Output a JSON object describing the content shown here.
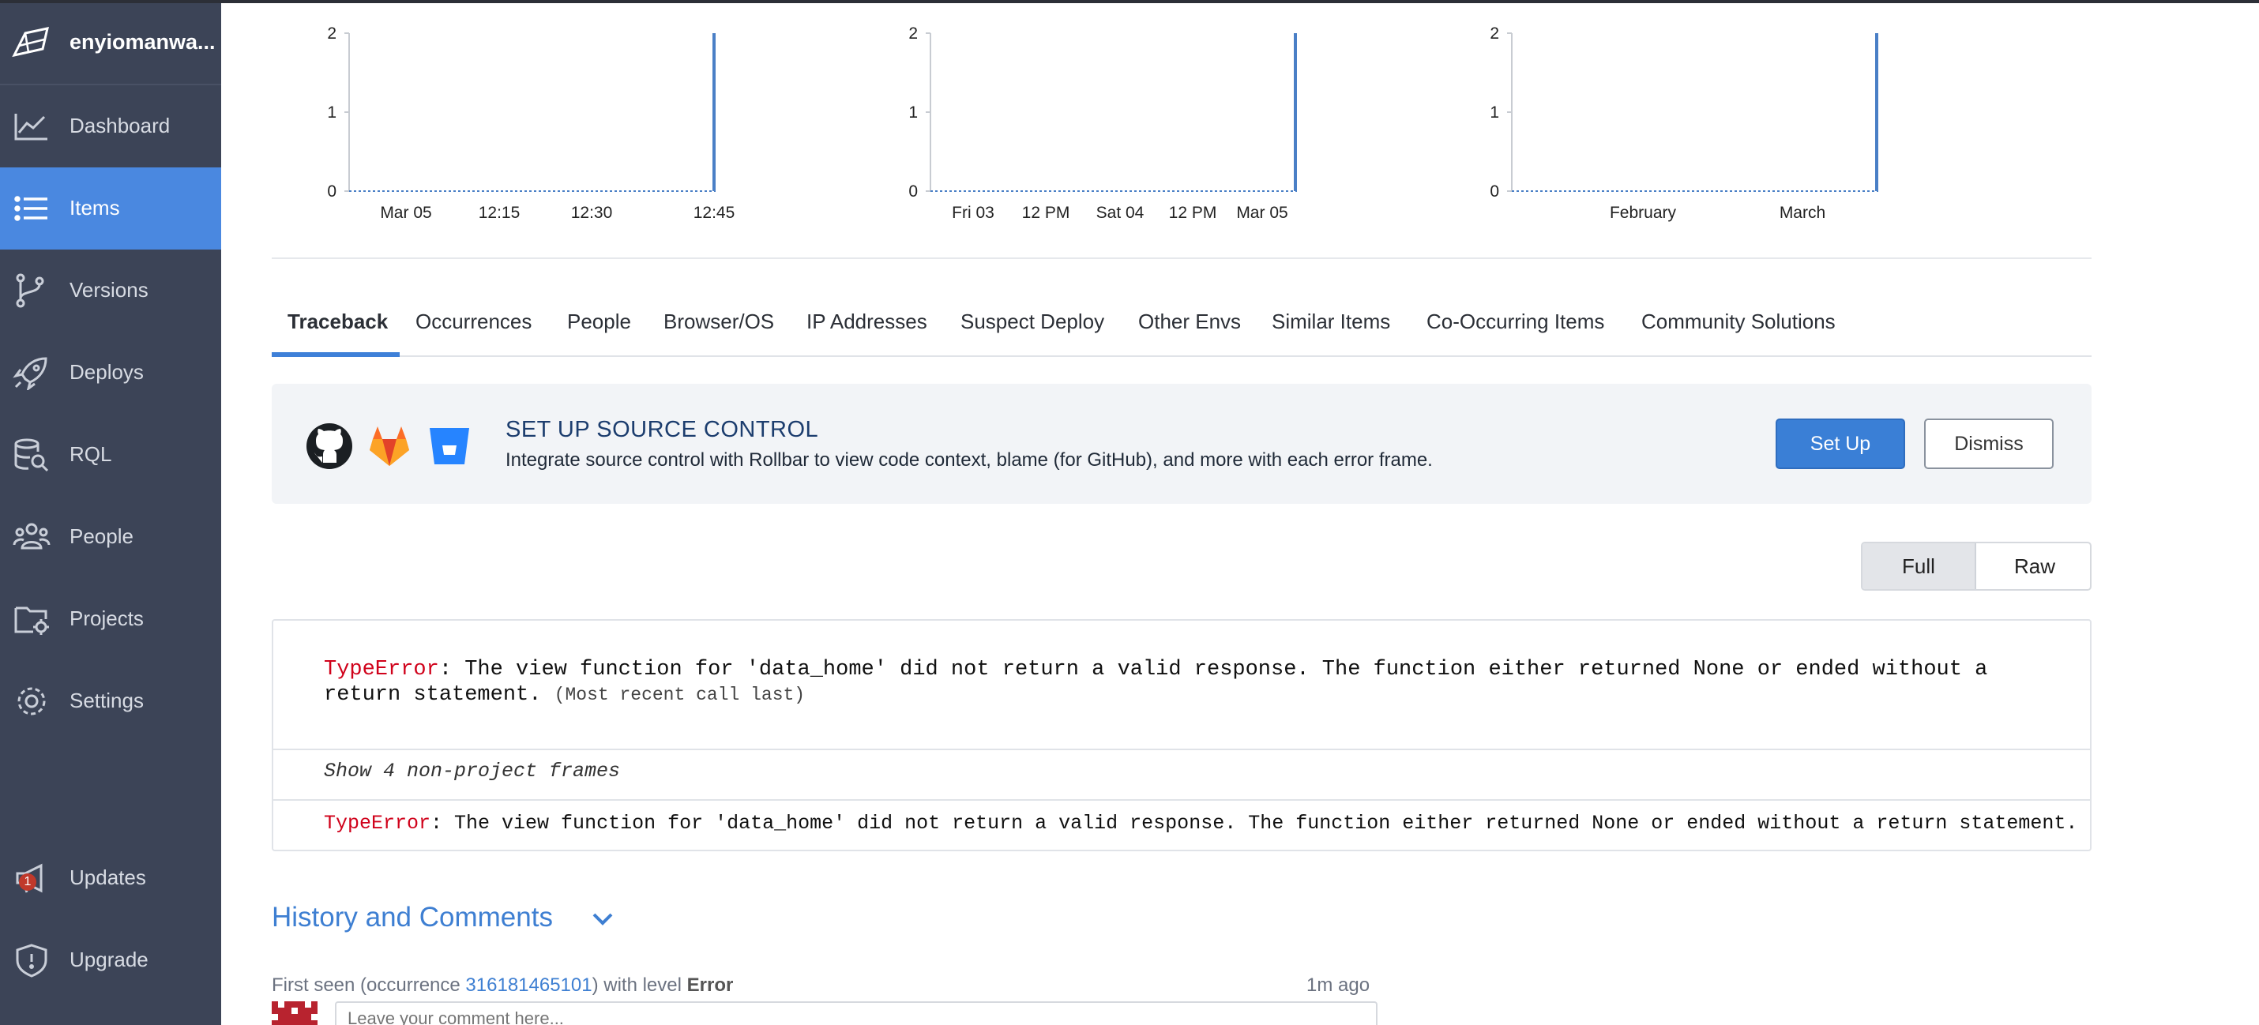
{
  "sidebar": {
    "org_name": "enyiomanwa...",
    "items": [
      {
        "label": "Dashboard",
        "icon": "chart-line-icon"
      },
      {
        "label": "Items",
        "icon": "list-icon",
        "active": true
      },
      {
        "label": "Versions",
        "icon": "branch-icon"
      },
      {
        "label": "Deploys",
        "icon": "rocket-icon"
      },
      {
        "label": "RQL",
        "icon": "database-search-icon"
      },
      {
        "label": "People",
        "icon": "people-icon"
      },
      {
        "label": "Projects",
        "icon": "folder-gear-icon"
      },
      {
        "label": "Settings",
        "icon": "gear-icon"
      }
    ],
    "updates": {
      "label": "Updates",
      "badge": "1"
    },
    "upgrade": {
      "label": "Upgrade"
    }
  },
  "chart_data": [
    {
      "type": "bar",
      "title": "",
      "y_ticks": [
        "0",
        "1",
        "2"
      ],
      "ylim": [
        0,
        2
      ],
      "x_ticks": [
        "Mar 05",
        "12:15",
        "12:30",
        "12:45"
      ],
      "spike_at": "end",
      "spike_value": 2
    },
    {
      "type": "bar",
      "title": "",
      "y_ticks": [
        "0",
        "1",
        "2"
      ],
      "ylim": [
        0,
        2
      ],
      "x_ticks": [
        "Fri 03",
        "12 PM",
        "Sat 04",
        "12 PM",
        "Mar 05"
      ],
      "spike_at": "end",
      "spike_value": 2
    },
    {
      "type": "bar",
      "title": "",
      "y_ticks": [
        "0",
        "1",
        "2"
      ],
      "ylim": [
        0,
        2
      ],
      "x_ticks": [
        "February",
        "March"
      ],
      "spike_at": "end",
      "spike_value": 2
    }
  ],
  "tabs": [
    "Traceback",
    "Occurrences",
    "People",
    "Browser/OS",
    "IP Addresses",
    "Suspect Deploy",
    "Other Envs",
    "Similar Items",
    "Co-Occurring Items",
    "Community Solutions"
  ],
  "banner": {
    "title": "SET UP SOURCE CONTROL",
    "description": "Integrate source control with Rollbar to view code context, blame (for GitHub), and more with each error frame.",
    "setup_label": "Set Up",
    "dismiss_label": "Dismiss"
  },
  "view_toggle": {
    "full": "Full",
    "raw": "Raw",
    "selected": "Full"
  },
  "traceback": {
    "error_type": "TypeError",
    "message": ": The view function for 'data_home' did not return a valid response. The function either returned None or ended without a return statement.",
    "recent_note": "(Most recent call last)",
    "hidden_frames": "Show 4 non-project frames",
    "final_error_type": "TypeError",
    "final_message": ": The view function for 'data_home' did not return a valid response. The function either returned None or ended without a return statement."
  },
  "history": {
    "title": "History and Comments",
    "first_seen_prefix": "First seen (occurrence ",
    "occurrence_id": "316181465101",
    "first_seen_mid": ") with level ",
    "level": "Error",
    "time": "1m ago",
    "comment_placeholder": "Leave your comment here..."
  },
  "colors": {
    "sidebar_bg": "#3c4457",
    "active_nav": "#4a88e0",
    "accent": "#3a7fd6",
    "error": "#d0021b"
  }
}
